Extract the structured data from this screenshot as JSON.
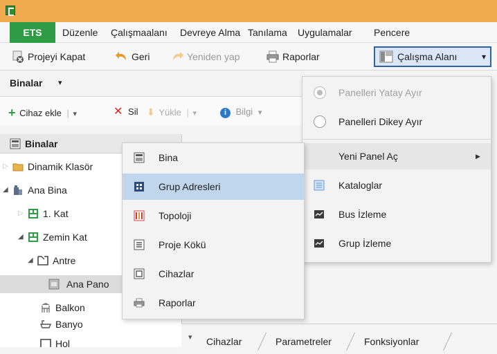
{
  "menubar": {
    "items": [
      "ETS",
      "Düzenle",
      "Çalışmaalanı",
      "Devreye Alma",
      "Tanılama",
      "Uygulamalar",
      "Pencere"
    ]
  },
  "toolbar": {
    "close_project": "Projeyi Kapat",
    "back": "Geri",
    "redo": "Yeniden yap",
    "reports": "Raporlar",
    "workspace": "Çalışma Alanı",
    "workspace_arrow": "▾"
  },
  "pane": {
    "title": "Binalar",
    "title_arrow": "▾",
    "add_device": "Cihaz ekle",
    "delete": "Sil",
    "upload": "Yükle",
    "info": "Bilgi"
  },
  "tree": {
    "header": "Binalar",
    "rows": [
      {
        "label": "Dinamik Klasör",
        "icon": "folder-icon"
      },
      {
        "label": "Ana Bina",
        "icon": "building-icon"
      },
      {
        "label": "1. Kat",
        "icon": "floor-icon"
      },
      {
        "label": "Zemin Kat",
        "icon": "floor-icon"
      },
      {
        "label": "Antre",
        "icon": "room-icon"
      },
      {
        "label": "Ana Pano",
        "icon": "panel-icon"
      },
      {
        "label": "Balkon",
        "icon": "balcony-icon"
      },
      {
        "label": "Banyo",
        "icon": "bath-icon"
      },
      {
        "label": "Hol",
        "icon": "room-icon"
      }
    ]
  },
  "tabs": [
    "Cihazlar",
    "Parametreler",
    "Fonksiyonlar"
  ],
  "workspace_menu": {
    "split_horizontal": "Panelleri Yatay Ayır",
    "split_vertical": "Panelleri Dikey Ayır",
    "new_panel": "Yeni Panel Aç",
    "catalogs": "Kataloglar",
    "bus_monitor": "Bus İzleme",
    "group_monitor": "Grup İzleme"
  },
  "new_panel_menu": {
    "items": [
      "Bina",
      "Grup Adresleri",
      "Topoloji",
      "Proje Kökü",
      "Cihazlar",
      "Raporlar"
    ]
  },
  "colors": {
    "accent_orange": "#f0a94c",
    "ets_green": "#2f9b45",
    "highlight_blue": "#bfd6ec",
    "active_border": "#2d62a8"
  }
}
